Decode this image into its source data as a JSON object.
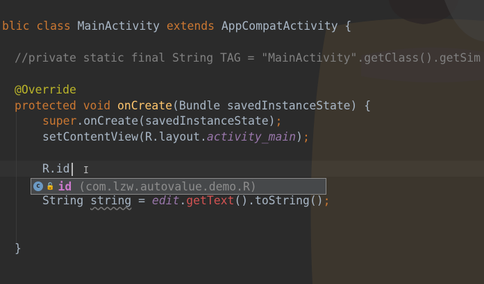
{
  "editor": {
    "lines": [
      {
        "indent": 0,
        "tokens": [
          {
            "t": "blic ",
            "c": "kw"
          },
          {
            "t": "class ",
            "c": "kw"
          },
          {
            "t": "MainActivity ",
            "c": ""
          },
          {
            "t": "extends ",
            "c": "kw"
          },
          {
            "t": "AppCompatActivity {",
            "c": ""
          }
        ]
      },
      {
        "indent": 0,
        "tokens": []
      },
      {
        "indent": 1,
        "tokens": [
          {
            "t": "//private static final String TAG = \"MainActivity\".getClass().getSim",
            "c": "cm"
          }
        ]
      },
      {
        "indent": 0,
        "tokens": []
      },
      {
        "indent": 1,
        "tokens": [
          {
            "t": "@Override",
            "c": "an"
          }
        ]
      },
      {
        "indent": 1,
        "tokens": [
          {
            "t": "protected ",
            "c": "kw"
          },
          {
            "t": "void ",
            "c": "kw"
          },
          {
            "t": "onCreate",
            "c": "fn"
          },
          {
            "t": "(Bundle savedInstanceState) {",
            "c": ""
          }
        ]
      },
      {
        "indent": 2,
        "tokens": [
          {
            "t": "super",
            "c": "kw"
          },
          {
            "t": ".onCreate(savedInstanceState)",
            "c": ""
          },
          {
            "t": ";",
            "c": "kw"
          }
        ]
      },
      {
        "indent": 2,
        "tokens": [
          {
            "t": "setContentView(R.layout.",
            "c": ""
          },
          {
            "t": "activity_main",
            "c": "it"
          },
          {
            "t": ")",
            "c": ""
          },
          {
            "t": ";",
            "c": "kw"
          }
        ]
      },
      {
        "indent": 0,
        "tokens": []
      },
      {
        "indent": 2,
        "tokens": [
          {
            "t": "R.id",
            "c": ""
          }
        ]
      },
      {
        "indent": 0,
        "tokens": []
      },
      {
        "indent": 2,
        "tokens": [
          {
            "t": "String ",
            "c": ""
          },
          {
            "t": "string",
            "c": "wv"
          },
          {
            "t": " = ",
            "c": ""
          },
          {
            "t": "edit",
            "c": "it"
          },
          {
            "t": ".",
            "c": ""
          },
          {
            "t": "getText",
            "c": "er"
          },
          {
            "t": "().toString()",
            "c": ""
          },
          {
            "t": ";",
            "c": "kw"
          }
        ]
      },
      {
        "indent": 0,
        "tokens": []
      },
      {
        "indent": 0,
        "tokens": []
      },
      {
        "indent": 1,
        "tokens": [
          {
            "t": "}",
            "c": ""
          }
        ]
      }
    ]
  },
  "completion": {
    "icon": "class-field-icon",
    "icon_glyph": "c",
    "lock_glyph": "🔓",
    "name": "id",
    "info": "(com.lzw.autovalue.demo.R)"
  }
}
